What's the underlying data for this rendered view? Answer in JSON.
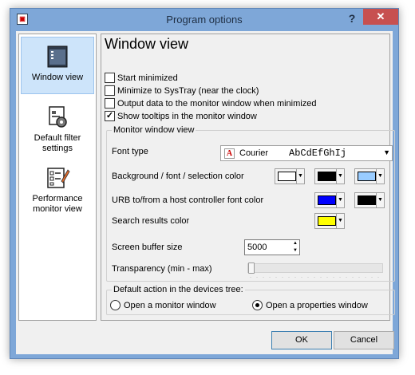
{
  "window": {
    "title": "Program options",
    "help_label": "?",
    "close_label": "✕",
    "app_icon": "app-icon"
  },
  "sidebar": {
    "items": [
      {
        "label": "Window view",
        "icon": "monitor-window-icon",
        "active": true
      },
      {
        "label": "Default filter settings",
        "icon": "filter-settings-icon",
        "active": false
      },
      {
        "label": "Performance monitor view",
        "icon": "performance-monitor-icon",
        "active": false
      }
    ]
  },
  "panel": {
    "title": "Window view",
    "checkboxes": [
      {
        "label": "Start minimized",
        "checked": false
      },
      {
        "label": "Minimize to SysTray (near the clock)",
        "checked": false
      },
      {
        "label": "Output data to the monitor window when minimized",
        "checked": false
      },
      {
        "label": "Show tooltips in the monitor window",
        "checked": true
      }
    ],
    "monitor_group": {
      "title": "Monitor window view",
      "font_type_label": "Font type",
      "font_name": "Courier",
      "font_preview": "AbCdEfGhIj",
      "bg_label": "Background / font / selection color",
      "bg_colors": [
        "#ffffff",
        "#000000",
        "#99ccff"
      ],
      "urb_label": "URB to/from a host controller font color",
      "urb_colors": [
        "#0000ff",
        "#000000"
      ],
      "search_label": "Search results color",
      "search_color": "#ffff00",
      "buffer_label": "Screen buffer size",
      "buffer_value": "5000",
      "transparency_label": "Transparency (min - max)",
      "transparency_level": 0.0
    },
    "default_action_group": {
      "title": "Default action in the devices tree:",
      "options": [
        {
          "label": "Open a monitor window",
          "selected": false
        },
        {
          "label": "Open a properties window",
          "selected": true
        }
      ]
    }
  },
  "footer": {
    "ok_label": "OK",
    "cancel_label": "Cancel"
  }
}
